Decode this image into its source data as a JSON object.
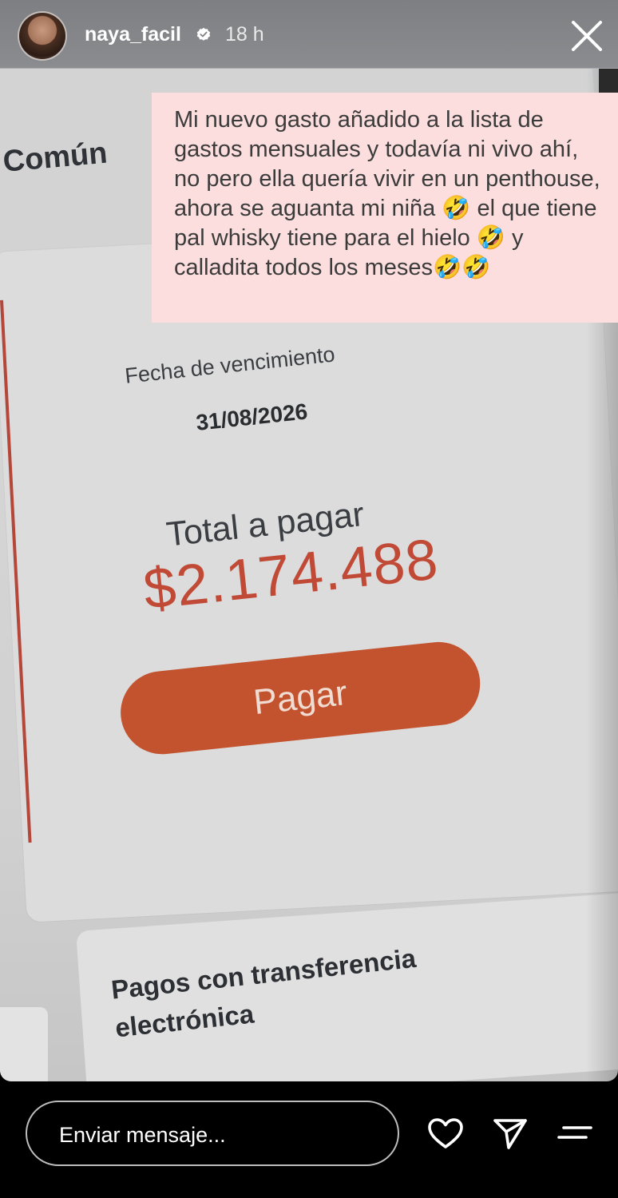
{
  "header": {
    "username": "naya_facil",
    "time_ago": "18 h",
    "verified": true
  },
  "caption": {
    "text": "Mi nuevo gasto añadido a la lista de gastos mensuales y todavía ni vivo ahí, no pero ella quería vivir en un penthouse, ahora se aguanta mi niña 🤣 el que tiene pal whisky tiene para el hielo 🤣 y calladita todos los meses🤣🤣"
  },
  "photo": {
    "section_title": "Común",
    "due_date_label": "Fecha de vencimiento",
    "due_date_value": "31/08/2026",
    "total_label": "Total a pagar",
    "total_value": "$2.174.488",
    "pay_button": "Pagar",
    "transfer_title": "Pagos con transferencia electrónica"
  },
  "bottom_bar": {
    "message_placeholder": "Enviar mensaje...",
    "icons": [
      "heart-icon",
      "send-icon",
      "menu-icon"
    ]
  },
  "colors": {
    "caption_bg": "#fcdede",
    "total_red": "#c14a37",
    "pay_button": "#c3522e"
  }
}
